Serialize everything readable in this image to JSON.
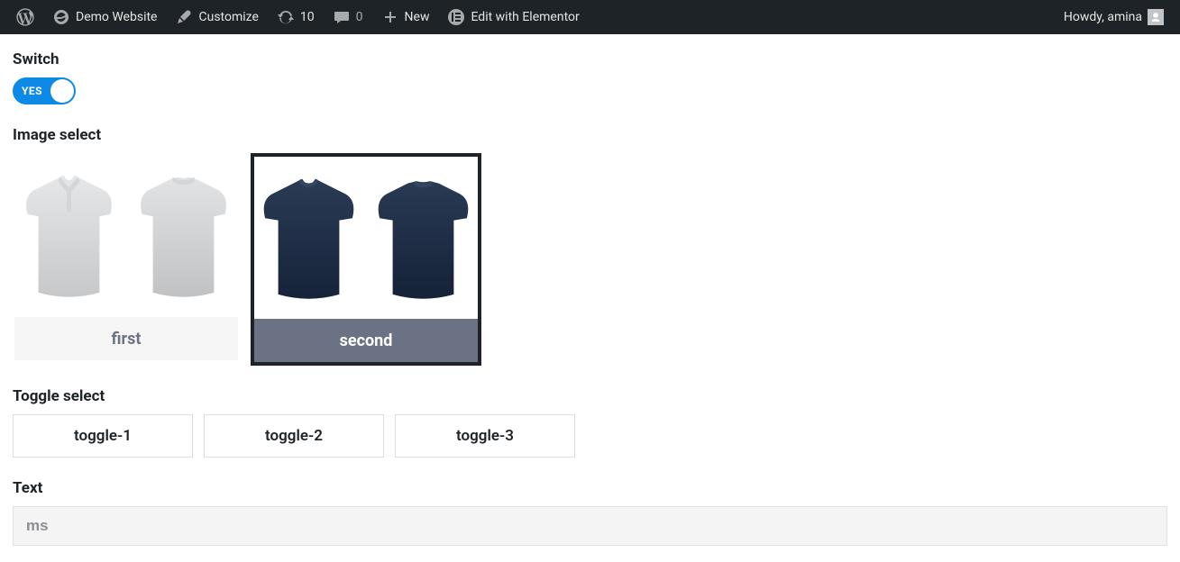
{
  "adminbar": {
    "site_name": "Demo Website",
    "customize": "Customize",
    "updates_count": "10",
    "comments_count": "0",
    "new_label": "New",
    "elementor": "Edit with Elementor",
    "howdy": "Howdy, amina"
  },
  "fields": {
    "switch": {
      "label": "Switch",
      "state_label": "YES"
    },
    "image_select": {
      "label": "Image select",
      "options": [
        {
          "label": "first"
        },
        {
          "label": "second"
        }
      ]
    },
    "toggle_select": {
      "label": "Toggle select",
      "options": [
        {
          "label": "toggle-1"
        },
        {
          "label": "toggle-2"
        },
        {
          "label": "toggle-3"
        }
      ]
    },
    "text": {
      "label": "Text",
      "value": "ms"
    }
  }
}
